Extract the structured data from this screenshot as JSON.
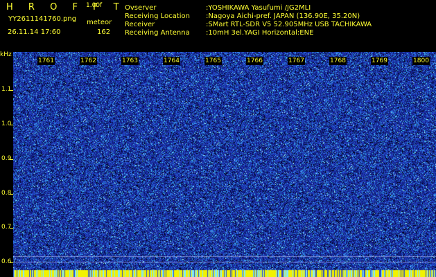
{
  "header": {
    "brand": "H R O F F T",
    "version": "1.00f",
    "filename": "YY2611141760.png",
    "meteor_label": "meteor",
    "datetime": "26.11.14 17:60",
    "meteor_count": "162"
  },
  "station_info": [
    {
      "label": "Ovserver",
      "value": ":YOSHIKAWA Yasufumi /JG2MLI"
    },
    {
      "label": "Receiving Location",
      "value": ":Nagoya Aichi-pref. JAPAN (136.90E, 35.20N)"
    },
    {
      "label": "Receiver",
      "value": ":SMart RTL-SDR V5 52.905MHz USB TACHIKAWA"
    },
    {
      "label": "Receiving Antenna",
      "value": ":10mH 3el.YAGI Horizontal:ENE"
    }
  ],
  "spectrogram": {
    "y_unit": "kHz",
    "y_ticks": [
      "1.1",
      "1.0",
      "0.9",
      "0.8",
      "0.7",
      "0.6"
    ],
    "time_labels": [
      "1761",
      "1762",
      "1763",
      "1764",
      "1765",
      "1766",
      "1767",
      "1768",
      "1769",
      "1800"
    ],
    "colors": {
      "background": "#1a2a9a",
      "speckle_light": "#4fd4ff",
      "speckle_dark": "#000014",
      "carrier_band": "#f2f200",
      "label": "#ffff33"
    }
  }
}
